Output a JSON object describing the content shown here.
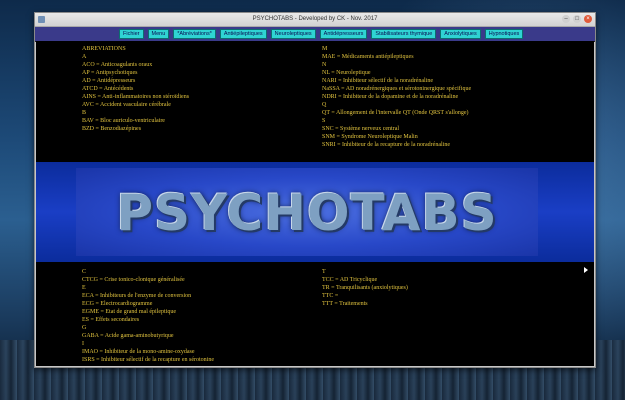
{
  "window": {
    "title": "PSYCHOTABS - Developed by CK - Nov. 2017"
  },
  "menu": [
    "Fichier",
    "Menu",
    "*Abréviations*",
    "Antiépileptiques",
    "Neuroleptiques",
    "Antidépresseurs",
    "Stabilisateurs thymique",
    "Anxiolytiques",
    "Hypnotiques"
  ],
  "banner_text": "PSYCHOTABS",
  "columns": {
    "left_top": [
      "ABREVIATIONS",
      "A",
      "ACO = Anticoagulants oraux",
      "AP = Antipsychotiques",
      "AD = Antidépresseurs",
      "ATCD = Antécédents",
      "AINS = Anti-inflammatoires non stéroïdiens",
      "AVC = Accident vasculaire cérébrale",
      "B",
      "BAV = Bloc auriculo-ventriculaire",
      "BZD = Benzodiazépines"
    ],
    "right_top": [
      "M",
      "MAE  = Médicaments antiépileptiques",
      "N",
      "NL = Neuroleptique",
      "NARI = Inhibiteur sélectif de la noradrénaline",
      "NaSSA = AD noradrénergiques et sérotoninergique spécifique",
      "NDRI = Inhibiteur de la dopamine et de la noradrénaline",
      "Q",
      "QT = Allongement de l'intervalle QT (Onde QRST s'allonge)",
      "S",
      "SNC = Système nerveux central",
      "SNM = Syndrome Neuroleptique Malin",
      "SNRI = Inhibiteur de la recapture de la noradrénaline"
    ],
    "left_bottom": [
      "C",
      "CTCG = Crise tonico-clonique généralisée",
      "E",
      "ECA = Inhibiteurs de l'enzyme de conversion",
      "ECG = Electrocardiogramme",
      "EGME = Etat de grand mal épileptique",
      "ES = Effets secondaires",
      "G",
      "GABA = Acide gama-aminobutyrique",
      "I",
      "IMAO = Inhibiteur de la mono-amine-oxydase",
      "ISRS = Inhibiteur sélectif de la recapture en sérotonine"
    ],
    "right_bottom": [
      "T",
      "TCC = AD Tricyclique",
      "TR = Tranquilisants (anxiolytiques)",
      "TTC =",
      "TTT = Traitements"
    ]
  }
}
